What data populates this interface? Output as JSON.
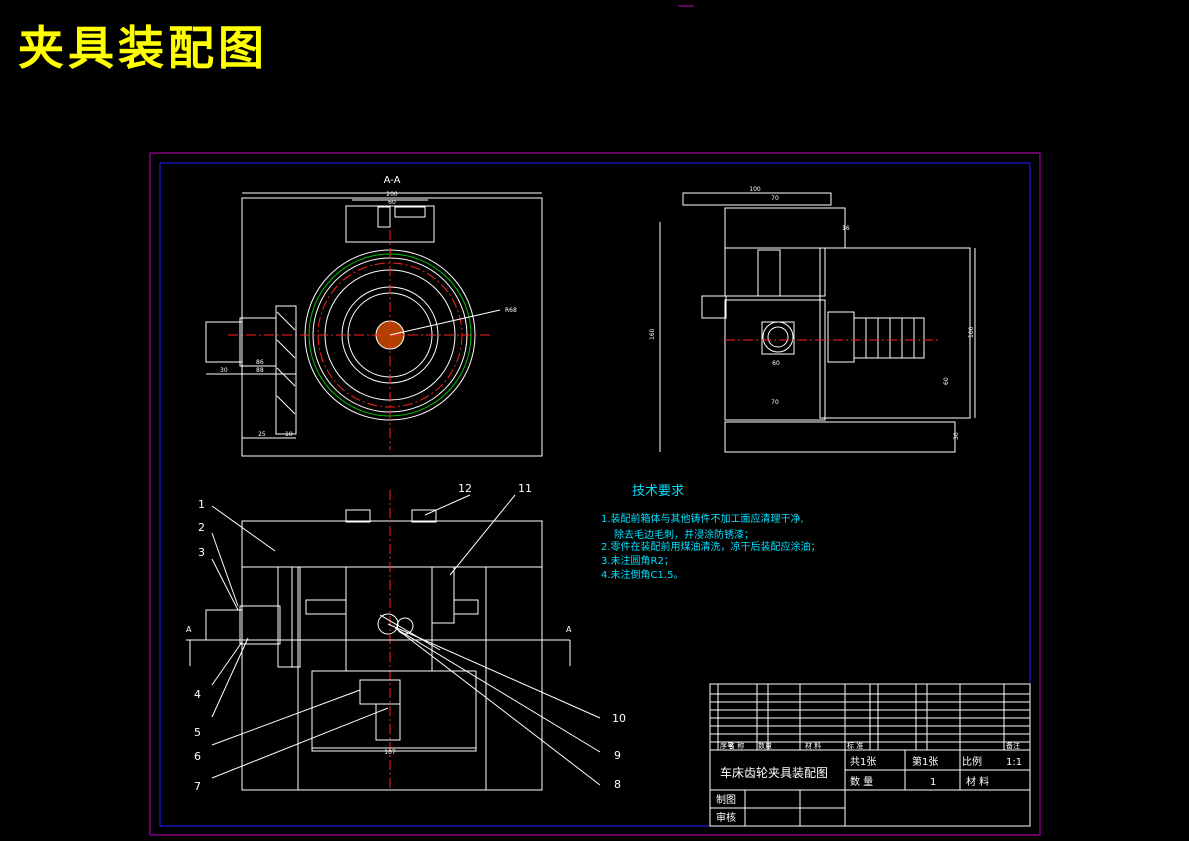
{
  "page_title": "夹具装配图",
  "views": {
    "section_label": "A-A",
    "section_marker": "A"
  },
  "dimensions": {
    "top_width_a": "200",
    "top_width_b": "60",
    "left_a": "30",
    "left_b": "88",
    "left_c": "86",
    "left_d": "25",
    "left_e": "10",
    "radius": "R68",
    "side_top_a": "100",
    "side_top_b": "70",
    "side_top_c": "16",
    "side_height": "160",
    "side_right_height": "100",
    "side_mid_a": "60",
    "side_low_a": "70",
    "side_small_a": "60",
    "side_bottom": "30",
    "front_bottom": "107"
  },
  "balloons": [
    "1",
    "2",
    "3",
    "4",
    "5",
    "6",
    "7",
    "8",
    "9",
    "10",
    "11",
    "12"
  ],
  "technical_requirements": {
    "heading": "技术要求",
    "items": [
      "1.装配前箱体与其他铸件不加工面应清理干净,",
      "除去毛边毛刺，并浸涂防锈漆；",
      "2.零件在装配前用煤油清洗，凉干后装配应涂油；",
      "3.未注圆角R2；",
      "4.未注倒角C1.5。"
    ]
  },
  "title_block": {
    "drawing_name": "车床齿轮夹具装配图",
    "sheets_total": "共1张",
    "sheet_no": "第1张",
    "scale_label": "比例",
    "scale_value": "1:1",
    "quantity_label": "数 量",
    "quantity_value": "1",
    "material_label": "材 料",
    "drawn_by_label": "制图",
    "checked_by_label": "审核",
    "bom_header": [
      "序号",
      "名 称",
      "数量",
      "材 料",
      "标 准",
      "备注"
    ]
  },
  "colors": {
    "background": "#000000",
    "title": "#ffff00",
    "outline": "#ffffff",
    "frame_outer": "#ff00ff",
    "frame_inner": "#0000ff",
    "centerline": "#ff2020",
    "notes": "#00e0ff",
    "pitch_circle": "#00c000"
  }
}
